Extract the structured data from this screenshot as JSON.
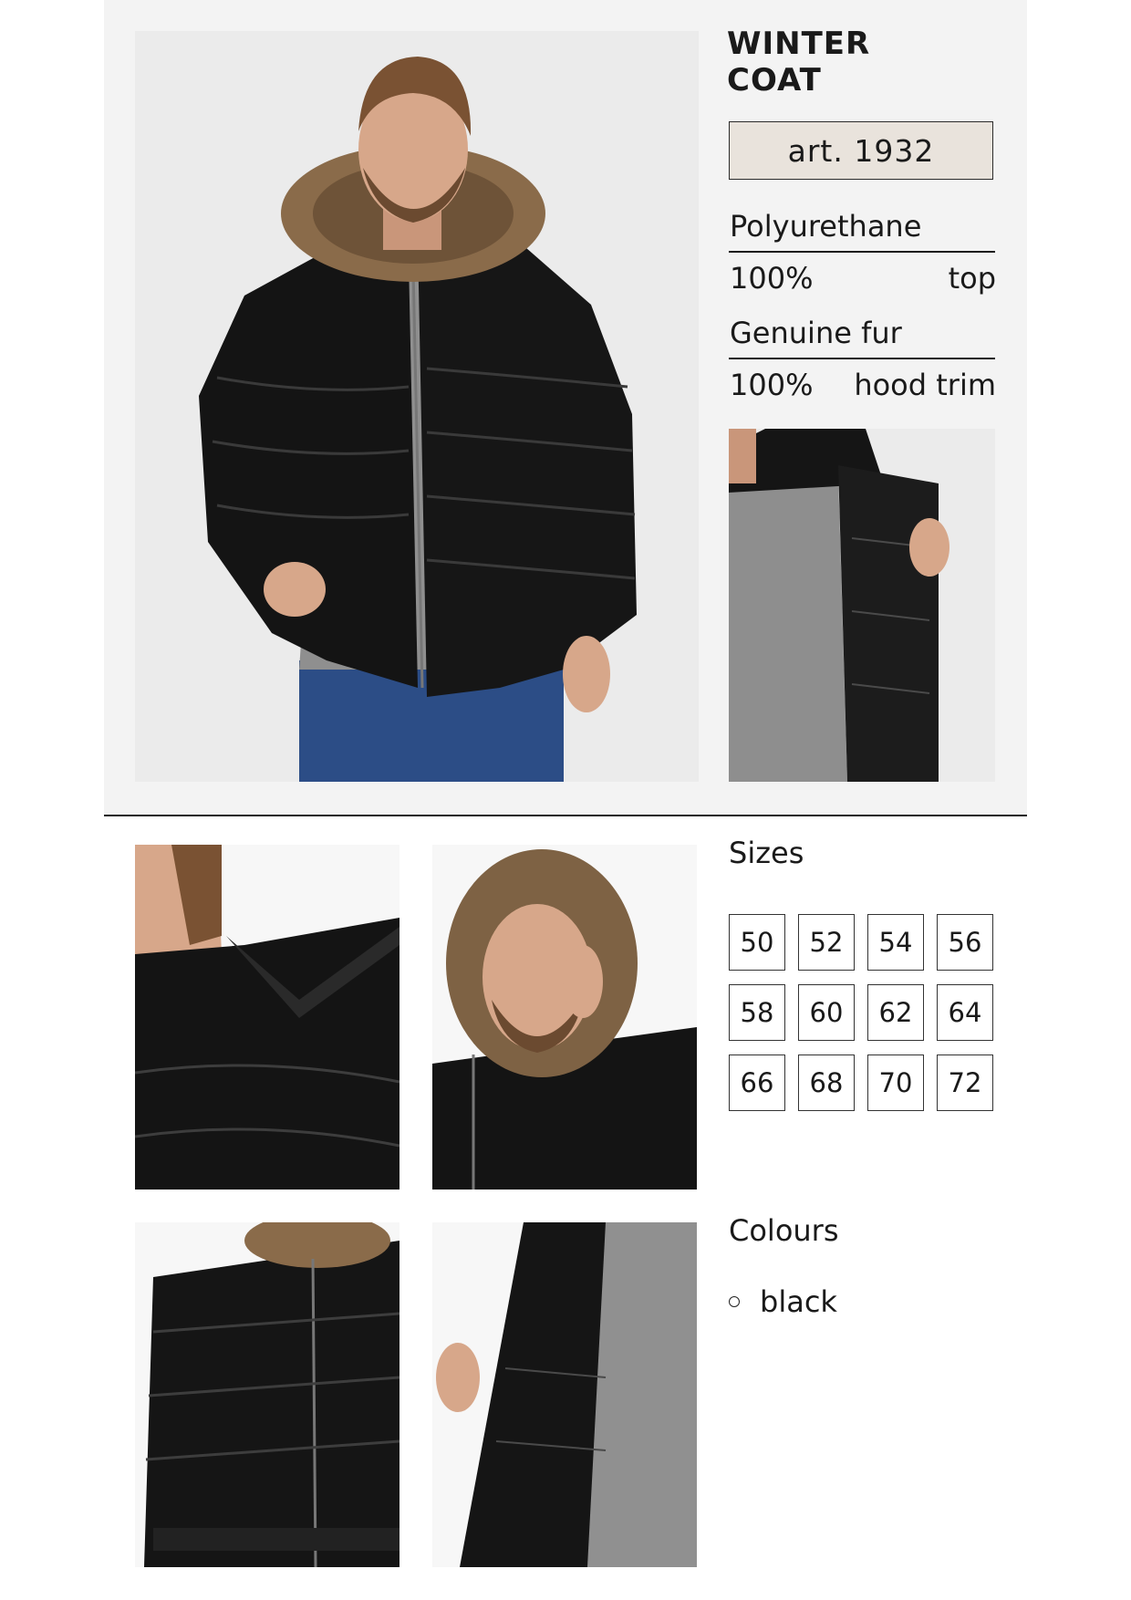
{
  "product": {
    "title_line1": "WINTER",
    "title_line2": "COAT",
    "article": "art. 1932"
  },
  "materials": [
    {
      "name": "Polyurethane",
      "percent": "100%",
      "part": "top"
    },
    {
      "name": "Genuine fur",
      "percent": "100%",
      "part": "hood trim"
    }
  ],
  "sizes": {
    "label": "Sizes",
    "values": [
      "50",
      "52",
      "54",
      "56",
      "58",
      "60",
      "62",
      "64",
      "66",
      "68",
      "70",
      "72"
    ]
  },
  "colours": {
    "label": "Colours",
    "values": [
      "black"
    ]
  },
  "colors": {
    "panel_bg": "#f3f3f3",
    "article_bg": "#e9e3dc",
    "jacket": "#141414",
    "fur": "#8a6b4a",
    "sweater": "#8f8f8f"
  }
}
